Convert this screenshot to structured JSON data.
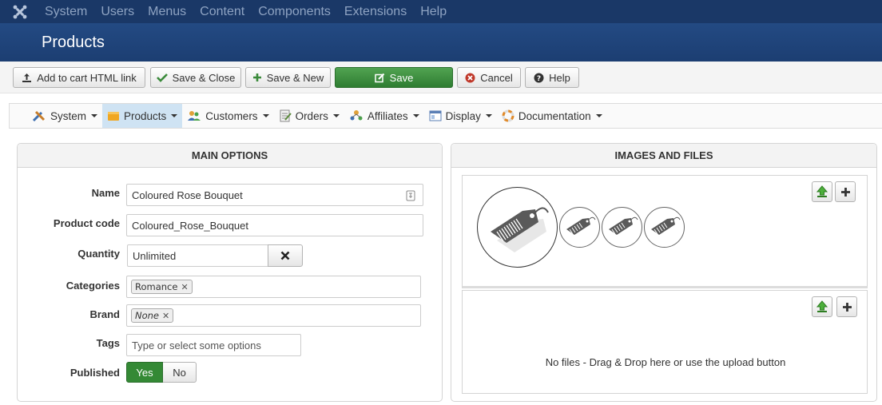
{
  "topmenu": {
    "items": [
      "System",
      "Users",
      "Menus",
      "Content",
      "Components",
      "Extensions",
      "Help"
    ]
  },
  "title": "Products",
  "toolbar": {
    "add_to_cart": "Add to cart HTML link",
    "save_close": "Save & Close",
    "save_new": "Save & New",
    "save": "Save",
    "cancel": "Cancel",
    "help": "Help"
  },
  "subnav": {
    "items": [
      "System",
      "Products",
      "Customers",
      "Orders",
      "Affiliates",
      "Display",
      "Documentation"
    ],
    "active": "Products"
  },
  "main_options": {
    "heading": "MAIN OPTIONS",
    "name_label": "Name",
    "name_value": "Coloured Rose Bouquet",
    "code_label": "Product code",
    "code_value": "Coloured_Rose_Bouquet",
    "quantity_label": "Quantity",
    "quantity_value": "Unlimited",
    "categories_label": "Categories",
    "categories": [
      "Romance"
    ],
    "brand_label": "Brand",
    "brand_value": "None",
    "tags_label": "Tags",
    "tags_placeholder": "Type or select some options",
    "published_label": "Published",
    "published_yes": "Yes",
    "published_no": "No",
    "published_value": "Yes"
  },
  "images_files": {
    "heading": "IMAGES AND FILES",
    "no_files": "No files - Drag & Drop here or use the upload button"
  },
  "colors": {
    "topbar": "#1a3867",
    "titlebar": "#234a83",
    "save_green": "#3f923f",
    "active_tab": "#cfe3f3"
  }
}
